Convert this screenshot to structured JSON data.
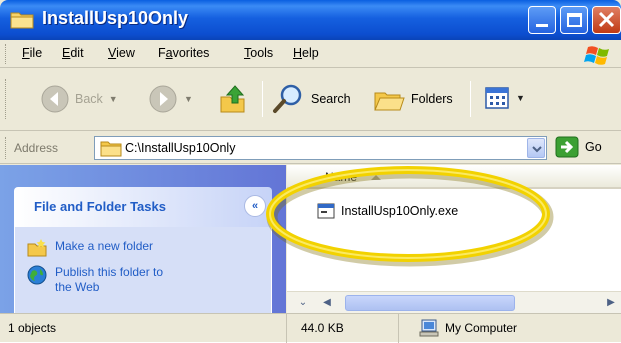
{
  "window": {
    "title": "InstallUsp10Only",
    "folder_icon": "folder-icon",
    "controls": [
      "minimize-icon",
      "maximize-icon",
      "close-icon"
    ]
  },
  "menu": {
    "items": [
      {
        "label": "File",
        "accel": "F",
        "rest": "ile"
      },
      {
        "label": "Edit",
        "accel": "E",
        "rest": "dit"
      },
      {
        "label": "View",
        "accel": "V",
        "rest": "iew"
      },
      {
        "label": "Favorites",
        "pre": "F",
        "accel": "a",
        "rest": "vorites"
      },
      {
        "label": "Tools",
        "accel": "T",
        "rest": "ools"
      },
      {
        "label": "Help",
        "accel": "H",
        "rest": "elp"
      }
    ]
  },
  "toolbar": {
    "back_label": "Back",
    "search_label": "Search",
    "folders_label": "Folders"
  },
  "address": {
    "label": "Address",
    "value": "C:\\InstallUsp10Only",
    "go_label": "Go"
  },
  "taskpane": {
    "title": "File and Folder Tasks",
    "tasks": [
      {
        "label": "Make a new folder"
      },
      {
        "label_line1": "Publish this folder to",
        "label_line2": "the Web"
      }
    ]
  },
  "filelist": {
    "column_name": "Name",
    "files": [
      {
        "name": "InstallUsp10Only.exe",
        "icon": "application-exe-icon"
      }
    ]
  },
  "status": {
    "objects": "1 objects",
    "size": "44.0 KB",
    "location": "My Computer"
  },
  "colors": {
    "titlebar": "#0c4ed0",
    "taskpane_link": "#215dc6",
    "highlight": "#f2d200"
  }
}
